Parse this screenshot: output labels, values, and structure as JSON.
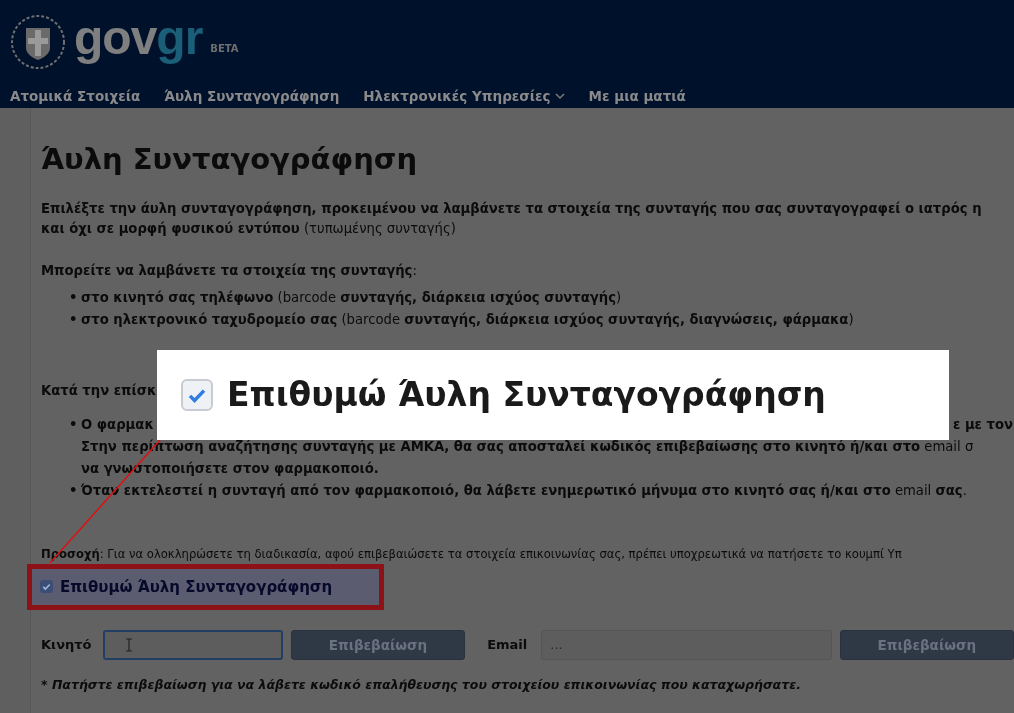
{
  "header": {
    "logo": {
      "part_1": "gov",
      "part_2": "gr",
      "badge": "BETA"
    },
    "nav": [
      {
        "label": "Ατομικά Στοιχεία",
        "dropdown": false
      },
      {
        "label": "Άυλη Συνταγογράφηση",
        "dropdown": false
      },
      {
        "label": "Ηλεκτρονικές Υπηρεσίες",
        "dropdown": true
      },
      {
        "label": "Με μια ματιά",
        "dropdown": false
      }
    ]
  },
  "title": "Άυλη Συνταγογράφηση",
  "intro": [
    "**Επιλέξτε την άυλη συνταγογράφηση, προκειμένου να λαμβάνετε τα στοιχεία της συνταγής που σας συνταγογραφεί ο ιατρός η**",
    "**και όχι σε μορφή φυσικού εντύπου** (τυπωμένης συνταγής)"
  ],
  "channels_heading": "**Μπορείτε να λαμβάνετε τα στοιχεία της συνταγής**:",
  "channels": [
    {
      "marker": "•",
      "text": "**στο κινητό σας τηλέφωνο** (barcode **συνταγής, διάρκεια ισχύος συνταγής**)"
    },
    {
      "marker": "•",
      "text": "**στο ηλεκτρονικό ταχυδρομείο σας** (barcode **συνταγής, διάρκεια ισχύος συνταγής, διαγνώσεις, φάρμακα**)"
    }
  ],
  "visit_heading": "Κατά την επίσκ",
  "visit_items": [
    {
      "marker": "•",
      "lines": [
        {
          "left": "Ο φαρμακ",
          "right": "ε με τον"
        },
        {
          "left": "**Στην περίπτωση αναζήτησης συνταγής με ΑΜΚΑ, θα σας αποσταλεί κωδικός επιβεβαίωσης στο κινητό ή/και στο** email σ"
        },
        {
          "left": "**να γνωστοποιήσετε στον φαρμακοποιό.**"
        }
      ]
    },
    {
      "marker": "•",
      "lines": [
        {
          "left": "**Όταν εκτελεστεί η συνταγή από τον φαρμακοποιό, θα λάβετε ενημερωτικό μήνυμα στο κινητό σας ή/και στο** email **σας**."
        }
      ]
    }
  ],
  "notice": "**Προσοχή**: Για να ολοκληρώσετε τη διαδικασία, αφού επιβεβαιώσετε τα στοιχεία επικοινωνίας σας, πρέπει υποχρεωτικά να πατήσετε το κουμπί Υπ",
  "opt_in": {
    "label": "Επιθυμώ Άυλη Συνταγογράφηση",
    "checked": true
  },
  "contacts": [
    {
      "label": "Κινητό",
      "focused": true,
      "button": "Επιβεβαίωση"
    },
    {
      "label": "Email",
      "placeholder": "...",
      "focused": false,
      "button": "Επιβεβαίωση"
    }
  ],
  "footnote": "* Πατήστε επιβεβαίωση για να λάβετε κωδικό επαλήθευσης του στοιχείου επικοινωνίας που καταχωρήσατε.",
  "callout": {
    "label": "Επιθυμώ Άυλη Συνταγογράφηση",
    "checked": true
  }
}
